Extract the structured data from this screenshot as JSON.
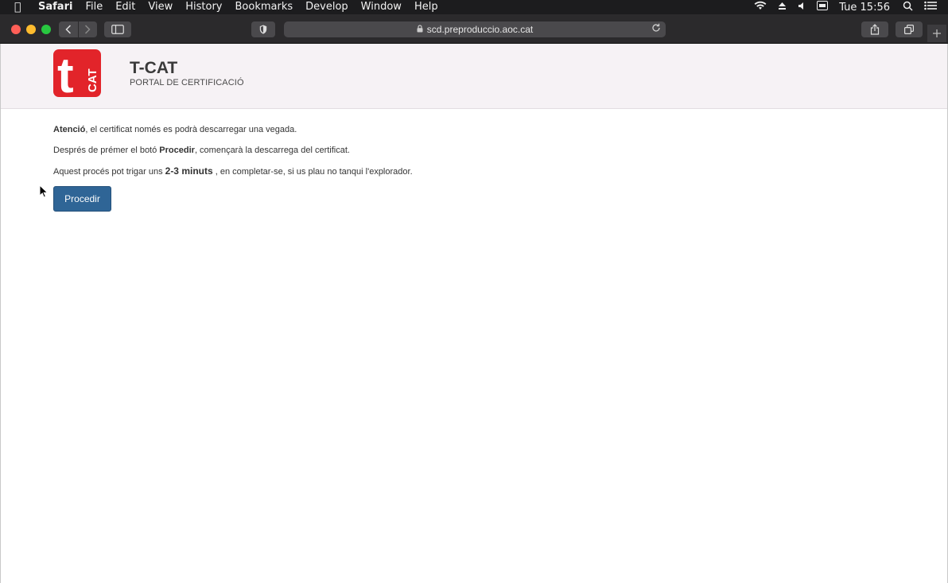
{
  "menubar": {
    "app": "Safari",
    "items": [
      "File",
      "Edit",
      "View",
      "History",
      "Bookmarks",
      "Develop",
      "Window",
      "Help"
    ],
    "clock": "Tue 15:56"
  },
  "browser": {
    "url": "scd.preproduccio.aoc.cat"
  },
  "header": {
    "logo_text_t": "t",
    "logo_text_cat": "CAT",
    "title": "T-CAT",
    "subtitle": "PORTAL DE CERTIFICACIÓ"
  },
  "content": {
    "line1_bold": "Atenció",
    "line1_rest": ", el certificat només es podrà descarregar una vegada.",
    "line2_pre": "Després de prémer el botó ",
    "line2_bold": "Procedir",
    "line2_rest": ", començarà la descarrega del certificat.",
    "line3_pre": "Aquest procés pot trigar uns ",
    "line3_bold": "2-3 minuts",
    "line3_rest": " , en completar-se, si us plau no tanqui l'explorador.",
    "button_label": "Procedir"
  },
  "colors": {
    "accent_button": "#2f6596",
    "logo_red": "#e2242a",
    "header_bg": "#f6f2f5"
  }
}
